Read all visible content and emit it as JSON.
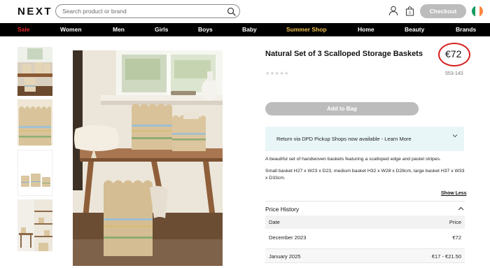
{
  "header": {
    "logo": "NEXT",
    "search_placeholder": "Search product or brand",
    "checkout_label": "Checkout",
    "flag_colors": [
      "#169b62",
      "#ffffff",
      "#ff883e"
    ]
  },
  "nav": {
    "items": [
      "Sale",
      "Women",
      "Men",
      "Girls",
      "Boys",
      "Baby",
      "Summer Shop",
      "Home",
      "Beauty",
      "Brands"
    ],
    "colors": {
      "Sale": "#e8262c",
      "Summer Shop": "#f3c04f",
      "default": "#ffffff"
    }
  },
  "product": {
    "title": "Natural Set of 3 Scalloped Storage Baskets",
    "price": "€72",
    "price_highlight_color": "#d81e1e",
    "rating_stars": "★★★★★",
    "rating_value": 0,
    "item_number": "553-143",
    "add_to_bag_label": "Add to Bag",
    "returns_text": "Return via DPD Pickup Shops now available - Learn More",
    "description_1": "A  beautiful set of handwoven baskets featuring a scalloped edge and pastel stripes.",
    "description_2": "Small basket H27 x W23 x D23, medium basket H32 x W28 x D28cm, large basket H37 x W33 x D33cm.",
    "show_less_label": "Show Less"
  },
  "price_history": {
    "title": "Price History",
    "columns": [
      "Date",
      "Price"
    ],
    "rows": [
      {
        "date": "December 2023",
        "price": "€72"
      },
      {
        "date": "January 2025",
        "price": "€17 - €21.50"
      }
    ]
  }
}
